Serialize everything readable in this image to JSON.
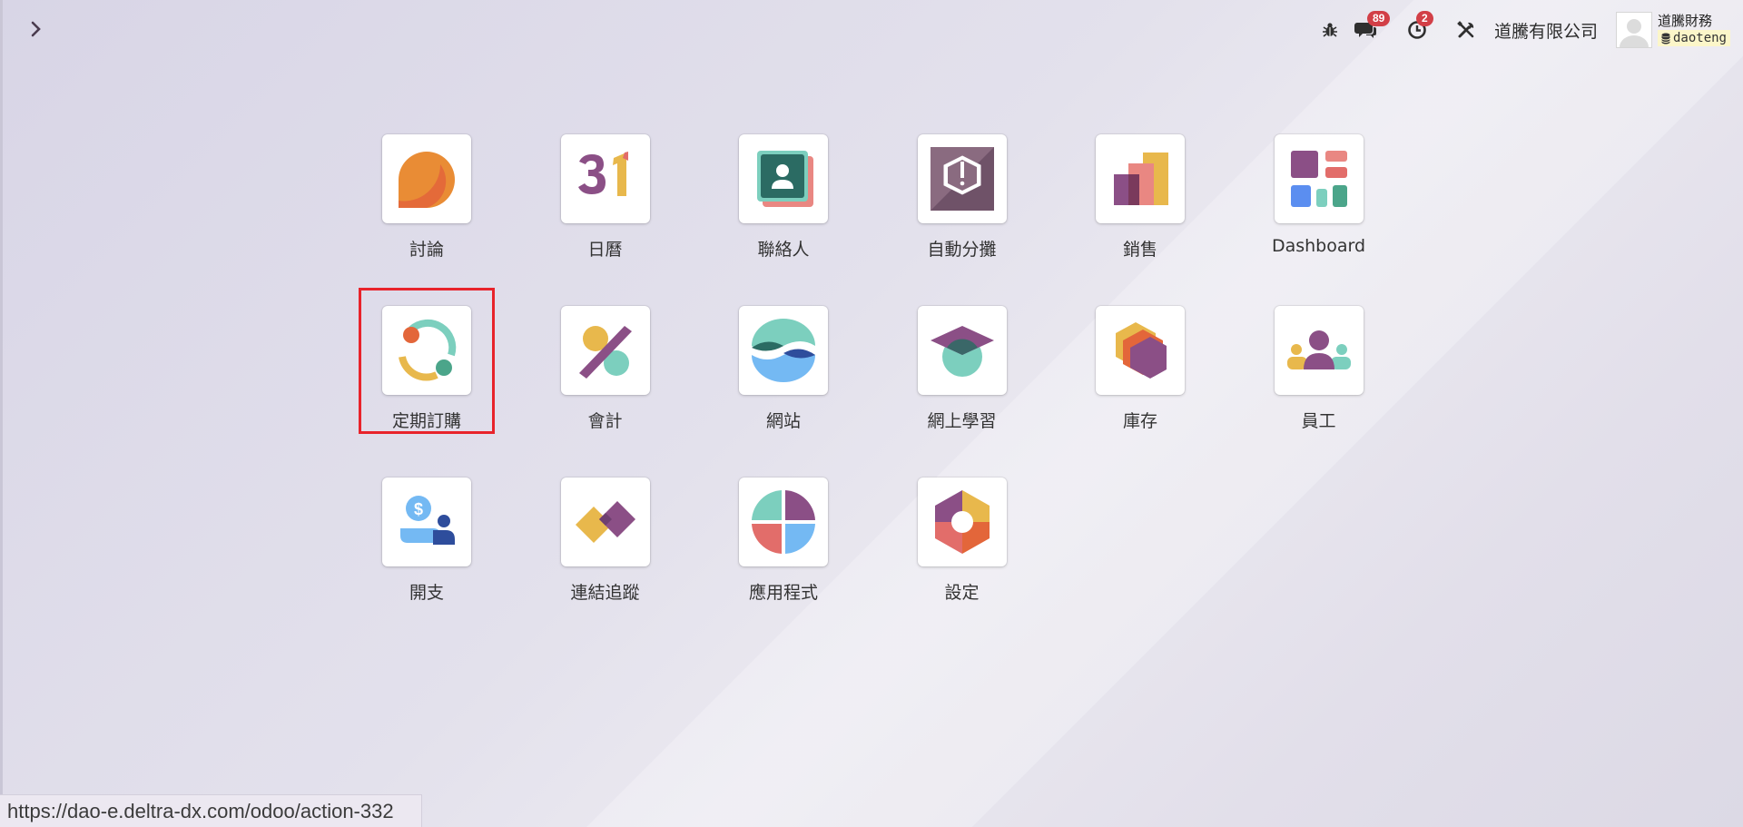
{
  "topbar": {
    "chat_badge": "89",
    "activity_badge": "2",
    "company_name": "道騰有限公司",
    "user_name": "道騰財務",
    "database": "daoteng"
  },
  "apps": [
    {
      "label": "討論",
      "icon": "discuss-icon"
    },
    {
      "label": "日曆",
      "icon": "calendar-icon"
    },
    {
      "label": "聯絡人",
      "icon": "contacts-icon"
    },
    {
      "label": "自動分攤",
      "icon": "auto-allocation-icon"
    },
    {
      "label": "銷售",
      "icon": "sales-icon"
    },
    {
      "label": "Dashboard",
      "icon": "dashboard-icon"
    },
    {
      "label": "定期訂購",
      "icon": "subscriptions-icon"
    },
    {
      "label": "會計",
      "icon": "accounting-icon"
    },
    {
      "label": "網站",
      "icon": "website-icon"
    },
    {
      "label": "網上學習",
      "icon": "elearning-icon"
    },
    {
      "label": "庫存",
      "icon": "inventory-icon"
    },
    {
      "label": "員工",
      "icon": "employees-icon"
    },
    {
      "label": "開支",
      "icon": "expenses-icon"
    },
    {
      "label": "連結追蹤",
      "icon": "link-tracker-icon"
    },
    {
      "label": "應用程式",
      "icon": "apps-icon"
    },
    {
      "label": "設定",
      "icon": "settings-icon"
    }
  ],
  "status_url": "https://dao-e.deltra-dx.com/odoo/action-332"
}
